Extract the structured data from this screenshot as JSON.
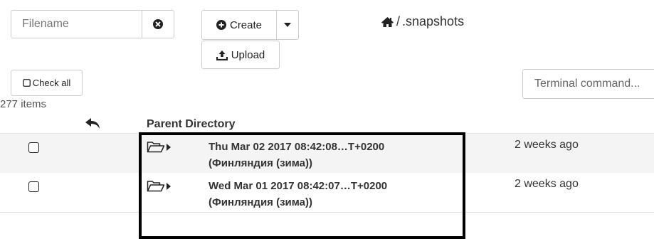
{
  "toolbar": {
    "filename_placeholder": "Filename",
    "create_label": "Create",
    "upload_label": "Upload",
    "check_all_label": "Check all",
    "terminal_placeholder": "Terminal command..."
  },
  "breadcrumb": {
    "separator": "/",
    "current": ".snapshots"
  },
  "listing": {
    "item_count": "277 items",
    "parent_label": "Parent Directory",
    "rows": [
      {
        "name_line1": "Thu Mar 02 2017 08:42:08…T+0200",
        "name_line2": "(Финляндия (зима))",
        "modified": "2 weeks ago"
      },
      {
        "name_line1": "Wed Mar 01 2017 08:42:07…T+0200",
        "name_line2": "(Финляндия (зима))",
        "modified": "2 weeks ago"
      }
    ]
  },
  "icons": {
    "clear": "times-circle-icon",
    "create": "plus-circle-icon",
    "caret": "caret-down-icon",
    "upload": "upload-icon",
    "home": "home-icon",
    "checkbox": "checkbox-icon",
    "parent": "reply-arrow-icon",
    "folder": "folder-open-icon",
    "expand": "caret-right-icon"
  },
  "colors": {
    "text": "#333333",
    "border": "#cccccc",
    "row_alt": "#f4f4f4",
    "highlight": "#000000"
  }
}
